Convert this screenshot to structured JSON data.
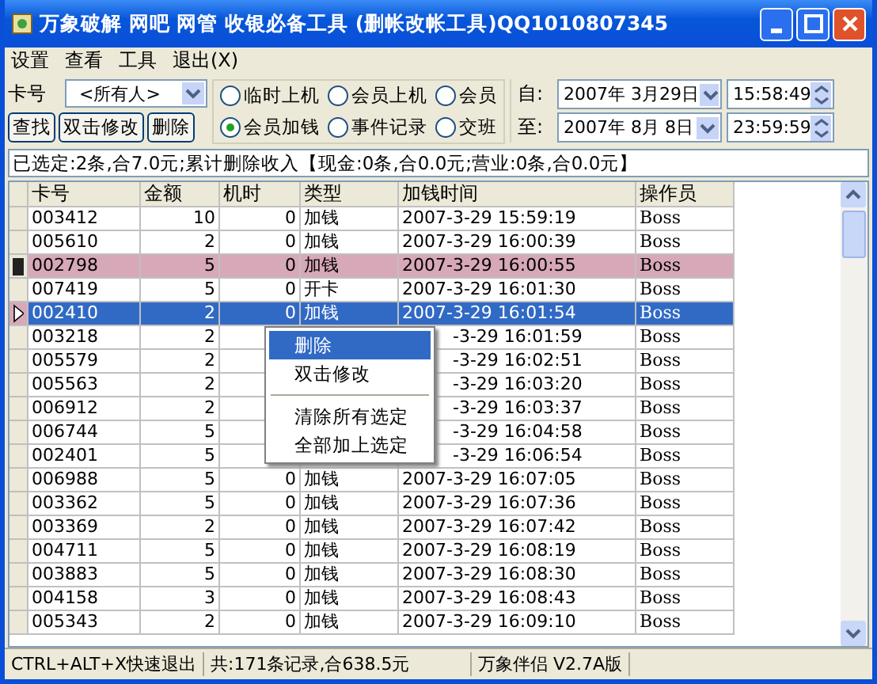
{
  "window": {
    "title": "万象破解 网吧 网管 收银必备工具 (删帐改帐工具)QQ1010807345"
  },
  "menu": [
    "设置",
    "查看",
    "工具",
    "退出(X)"
  ],
  "filter": {
    "card_label": "卡号",
    "card_value": "<所有人>",
    "buttons": [
      "查找",
      "双击修改",
      "删除"
    ],
    "radios": [
      {
        "label": "临时上机",
        "selected": false
      },
      {
        "label": "会员上机",
        "selected": false
      },
      {
        "label": "会员",
        "selected": false
      },
      {
        "label": "会员加钱",
        "selected": true
      },
      {
        "label": "事件记录",
        "selected": false
      },
      {
        "label": "交班",
        "selected": false
      }
    ],
    "from": {
      "label": "自:",
      "date": "2007年 3月29日",
      "time": "15:58:49"
    },
    "to": {
      "label": "至:",
      "date": "2007年 8月 8日",
      "time": "23:59:59"
    }
  },
  "summary": "已选定:2条,合7.0元;累计删除收入【现金:0条,合0.0元;营业:0条,合0.0元】",
  "table": {
    "columns": [
      "卡号",
      "金额",
      "机时",
      "类型",
      "加钱时间",
      "操作员"
    ],
    "rows": [
      {
        "card": "003412",
        "amount": "10",
        "hours": "0",
        "type": "加钱",
        "time": "2007-3-29 15:59:19",
        "operator": "Boss",
        "selected": false,
        "current": false,
        "covered": false
      },
      {
        "card": "005610",
        "amount": "2",
        "hours": "0",
        "type": "加钱",
        "time": "2007-3-29 16:00:39",
        "operator": "Boss",
        "selected": false,
        "current": false,
        "covered": false
      },
      {
        "card": "002798",
        "amount": "5",
        "hours": "0",
        "type": "加钱",
        "time": "2007-3-29 16:00:55",
        "operator": "Boss",
        "selected": true,
        "current": false,
        "covered": false
      },
      {
        "card": "007419",
        "amount": "5",
        "hours": "0",
        "type": "开卡",
        "time": "2007-3-29 16:01:30",
        "operator": "Boss",
        "selected": false,
        "current": false,
        "covered": false
      },
      {
        "card": "002410",
        "amount": "2",
        "hours": "0",
        "type": "加钱",
        "time": "2007-3-29 16:01:54",
        "operator": "Boss",
        "selected": true,
        "current": true,
        "covered": false
      },
      {
        "card": "003218",
        "amount": "2",
        "time": "-3-29 16:01:59",
        "operator": "Boss",
        "selected": false,
        "current": false,
        "covered": true
      },
      {
        "card": "005579",
        "amount": "2",
        "time": "-3-29 16:02:51",
        "operator": "Boss",
        "selected": false,
        "current": false,
        "covered": true
      },
      {
        "card": "005563",
        "amount": "2",
        "time": "-3-29 16:03:20",
        "operator": "Boss",
        "selected": false,
        "current": false,
        "covered": true
      },
      {
        "card": "006912",
        "amount": "2",
        "time": "-3-29 16:03:37",
        "operator": "Boss",
        "selected": false,
        "current": false,
        "covered": true
      },
      {
        "card": "006744",
        "amount": "5",
        "time": "-3-29 16:04:58",
        "operator": "Boss",
        "selected": false,
        "current": false,
        "covered": true
      },
      {
        "card": "002401",
        "amount": "5",
        "time": "-3-29 16:06:54",
        "operator": "Boss",
        "selected": false,
        "current": false,
        "covered": true
      },
      {
        "card": "006988",
        "amount": "5",
        "hours": "0",
        "type": "加钱",
        "time": "2007-3-29 16:07:05",
        "operator": "Boss",
        "selected": false,
        "current": false,
        "covered": false
      },
      {
        "card": "003362",
        "amount": "5",
        "hours": "0",
        "type": "加钱",
        "time": "2007-3-29 16:07:36",
        "operator": "Boss",
        "selected": false,
        "current": false,
        "covered": false
      },
      {
        "card": "003369",
        "amount": "2",
        "hours": "0",
        "type": "加钱",
        "time": "2007-3-29 16:07:42",
        "operator": "Boss",
        "selected": false,
        "current": false,
        "covered": false
      },
      {
        "card": "004711",
        "amount": "5",
        "hours": "0",
        "type": "加钱",
        "time": "2007-3-29 16:08:19",
        "operator": "Boss",
        "selected": false,
        "current": false,
        "covered": false
      },
      {
        "card": "003883",
        "amount": "5",
        "hours": "0",
        "type": "加钱",
        "time": "2007-3-29 16:08:30",
        "operator": "Boss",
        "selected": false,
        "current": false,
        "covered": false
      },
      {
        "card": "004158",
        "amount": "3",
        "hours": "0",
        "type": "加钱",
        "time": "2007-3-29 16:08:43",
        "operator": "Boss",
        "selected": false,
        "current": false,
        "covered": false
      },
      {
        "card": "005343",
        "amount": "2",
        "hours": "0",
        "type": "加钱",
        "time": "2007-3-29 16:09:10",
        "operator": "Boss",
        "selected": false,
        "current": false,
        "covered": false
      }
    ]
  },
  "context_menu": [
    {
      "label": "删除",
      "selected": true
    },
    {
      "label": "双击修改",
      "selected": false
    },
    {
      "kind": "separator"
    },
    {
      "label": "清除所有选定",
      "selected": false
    },
    {
      "label": "全部加上选定",
      "selected": false
    }
  ],
  "status_bar": [
    "CTRL+ALT+X快速退出",
    "共:171条记录,合638.5元",
    "万象伴侣 V2.7A版"
  ]
}
